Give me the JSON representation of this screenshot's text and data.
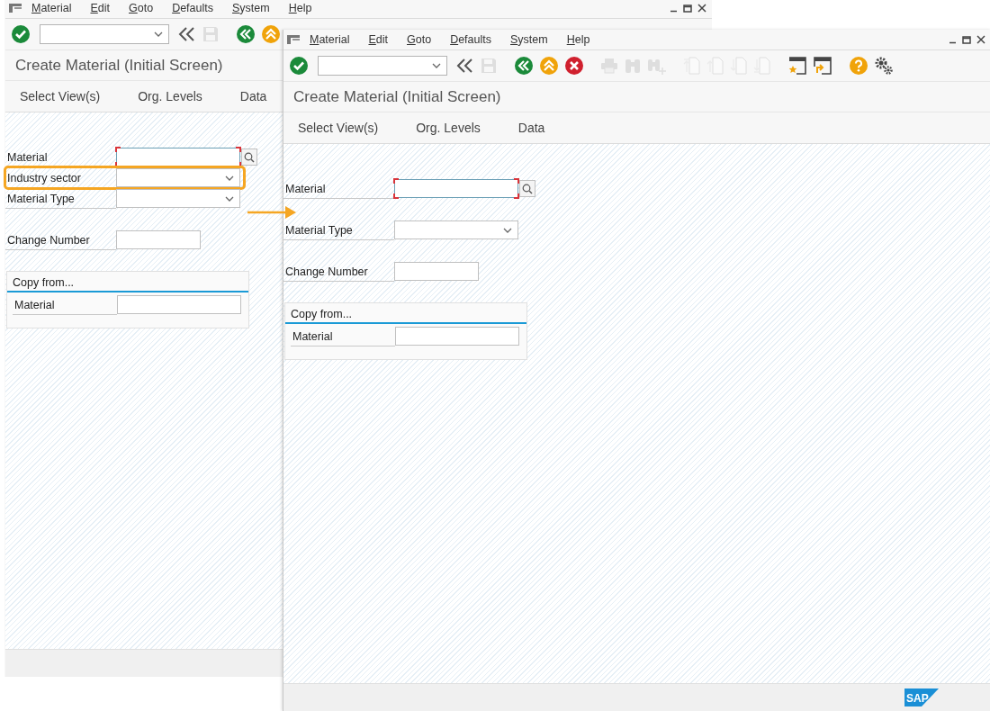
{
  "windows": [
    {
      "menu": [
        "Material",
        "Edit",
        "Goto",
        "Defaults",
        "System",
        "Help"
      ],
      "toolbar": [
        [
          {
            "kind": "confirm",
            "disabled": false
          },
          {
            "kind": "command",
            "disabled": false
          },
          {
            "kind": "collapse",
            "disabled": false
          },
          {
            "kind": "save",
            "disabled": true
          }
        ],
        [
          {
            "kind": "back",
            "disabled": false
          },
          {
            "kind": "exit",
            "disabled": false
          }
        ]
      ],
      "title": "Create Material (Initial Screen)",
      "tabs": [
        "Select View(s)",
        "Org. Levels",
        "Data"
      ],
      "field_groups": [
        [
          {
            "label": "Material",
            "kind": "input",
            "required": true,
            "search_help": true,
            "highlighted": false
          },
          {
            "label": "Industry sector",
            "kind": "dropdown",
            "required": false,
            "search_help": false,
            "highlighted": true
          },
          {
            "label": "Material Type",
            "kind": "dropdown",
            "required": false,
            "search_help": false,
            "highlighted": false
          }
        ],
        [
          {
            "label": "Change Number",
            "kind": "short",
            "required": false,
            "search_help": false,
            "highlighted": false
          }
        ]
      ],
      "copy_from": {
        "title": "Copy from...",
        "fields": [
          {
            "label": "Material",
            "kind": "input",
            "required": false,
            "search_help": false,
            "highlighted": false
          }
        ]
      }
    },
    {
      "menu": [
        "Material",
        "Edit",
        "Goto",
        "Defaults",
        "System",
        "Help"
      ],
      "toolbar": [
        [
          {
            "kind": "confirm",
            "disabled": false
          },
          {
            "kind": "command",
            "disabled": false
          },
          {
            "kind": "collapse",
            "disabled": false
          },
          {
            "kind": "save",
            "disabled": true
          }
        ],
        [
          {
            "kind": "back",
            "disabled": false
          },
          {
            "kind": "exit",
            "disabled": false
          },
          {
            "kind": "cancel",
            "disabled": false
          }
        ],
        [
          {
            "kind": "print",
            "disabled": true
          },
          {
            "kind": "find",
            "disabled": true
          },
          {
            "kind": "find-next",
            "disabled": true
          }
        ],
        [
          {
            "kind": "first-page",
            "disabled": true
          },
          {
            "kind": "prev-page",
            "disabled": true
          },
          {
            "kind": "next-page",
            "disabled": true
          },
          {
            "kind": "last-page",
            "disabled": true
          }
        ],
        [
          {
            "kind": "new-session",
            "disabled": false
          },
          {
            "kind": "shortcut",
            "disabled": false
          }
        ],
        [
          {
            "kind": "help",
            "disabled": false
          },
          {
            "kind": "settings",
            "disabled": false
          }
        ]
      ],
      "title": "Create Material (Initial Screen)",
      "tabs": [
        "Select View(s)",
        "Org. Levels",
        "Data"
      ],
      "field_groups": [
        [
          {
            "label": "Material",
            "kind": "input",
            "required": true,
            "search_help": true,
            "highlighted": false
          }
        ],
        [
          {
            "label": "Material Type",
            "kind": "dropdown",
            "required": false,
            "search_help": false,
            "highlighted": false
          }
        ],
        [
          {
            "label": "Change Number",
            "kind": "short",
            "required": false,
            "search_help": false,
            "highlighted": false
          }
        ]
      ],
      "copy_from": {
        "title": "Copy from...",
        "fields": [
          {
            "label": "Material",
            "kind": "input",
            "required": false,
            "search_help": false,
            "highlighted": false
          }
        ]
      },
      "status_bar": {
        "logo": "SAP"
      }
    }
  ]
}
